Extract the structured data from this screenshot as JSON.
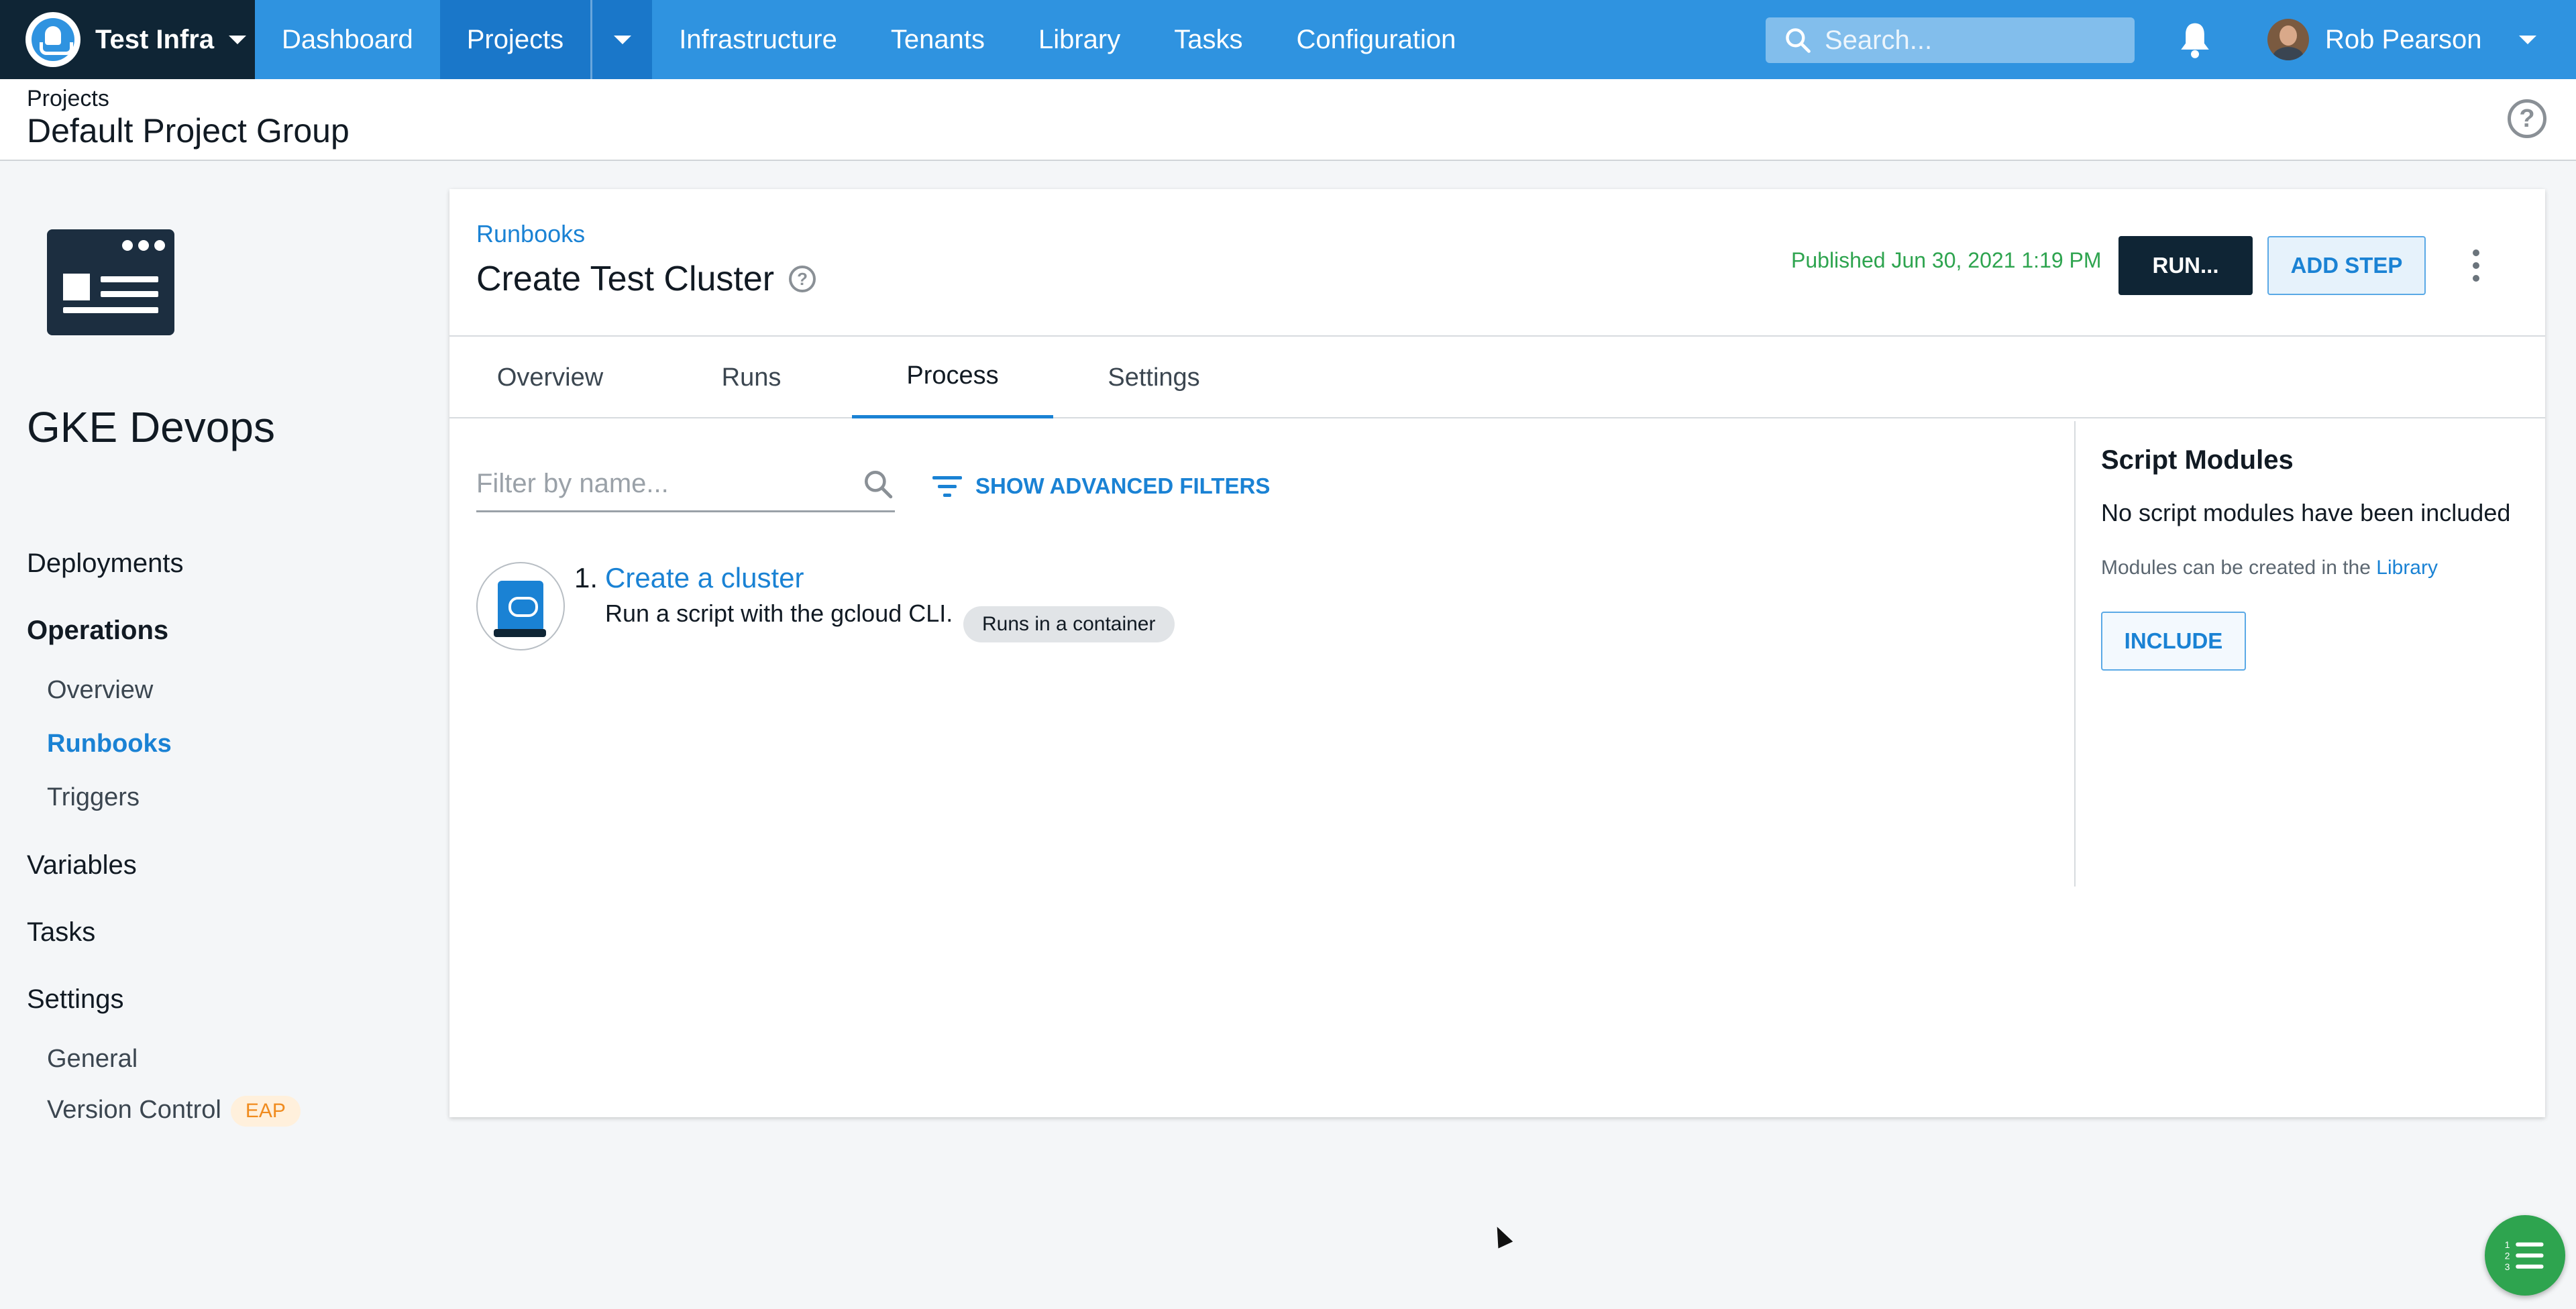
{
  "topnav": {
    "space_name": "Test Infra",
    "items": [
      {
        "label": "Dashboard"
      },
      {
        "label": "Projects"
      },
      {
        "label": "Infrastructure"
      },
      {
        "label": "Tenants"
      },
      {
        "label": "Library"
      },
      {
        "label": "Tasks"
      },
      {
        "label": "Configuration"
      }
    ],
    "active_item": "Projects",
    "search_placeholder": "Search...",
    "user_name": "Rob Pearson",
    "accent_color": "#2f93e0",
    "icons": [
      "octopus-logo-icon",
      "caret-down-icon",
      "search-icon",
      "bell-icon",
      "avatar"
    ]
  },
  "header": {
    "breadcrumb": "Projects",
    "title": "Default Project Group",
    "help_icon": "help-circle-icon"
  },
  "sidebar": {
    "project_name": "GKE Devops",
    "project_icon": "runbook-window-icon",
    "items": [
      {
        "label": "Deployments"
      },
      {
        "label": "Operations"
      },
      {
        "label": "Overview"
      },
      {
        "label": "Runbooks"
      },
      {
        "label": "Triggers"
      },
      {
        "label": "Variables"
      },
      {
        "label": "Tasks"
      },
      {
        "label": "Settings"
      },
      {
        "label": "General"
      },
      {
        "label": "Version Control"
      }
    ],
    "version_control_badge": "EAP",
    "active_item": "Runbooks"
  },
  "runbook": {
    "breadcrumb": "Runbooks",
    "title": "Create Test Cluster",
    "published": "Published Jun 30, 2021 1:19 PM",
    "run_label": "RUN...",
    "add_step_label": "ADD STEP",
    "tabs": [
      {
        "label": "Overview"
      },
      {
        "label": "Runs"
      },
      {
        "label": "Process"
      },
      {
        "label": "Settings"
      }
    ],
    "active_tab": "Process"
  },
  "process": {
    "filter_placeholder": "Filter by name...",
    "advanced_filters_label": "SHOW ADVANCED FILTERS",
    "steps": [
      {
        "number": "1.",
        "name": "Create a cluster",
        "description": "Run a script with the gcloud CLI.",
        "badge": "Runs in a container",
        "icon": "gcloud-script-icon"
      }
    ]
  },
  "script_modules": {
    "title": "Script Modules",
    "none_text": "No script modules have been included",
    "hint_prefix": "Modules can be created in the",
    "hint_link": "Library",
    "include_label": "INCLUDE"
  },
  "fab_icon": "numbered-list-icon"
}
